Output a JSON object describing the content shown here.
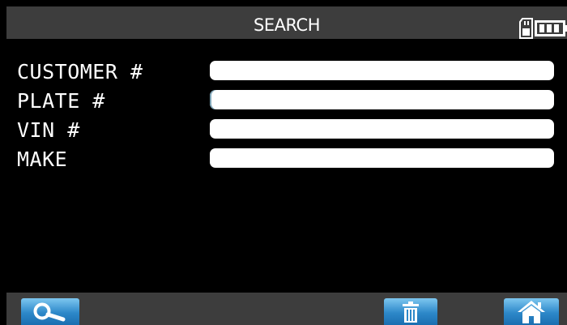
{
  "header": {
    "title": "SEARCH"
  },
  "form": {
    "fields": [
      {
        "label": "CUSTOMER #",
        "value": ""
      },
      {
        "label": "PLATE #",
        "value": ""
      },
      {
        "label": "VIN #",
        "value": ""
      },
      {
        "label": "MAKE",
        "value": ""
      }
    ]
  },
  "footer": {
    "buttons": [
      {
        "icon": "search-icon"
      },
      {
        "icon": "trash-icon"
      },
      {
        "icon": "home-icon"
      }
    ]
  },
  "colors": {
    "bar_background": "#3d3d3d",
    "screen_background": "#000000",
    "button_blue": "#2d88c9",
    "field_background": "#ffffff"
  }
}
